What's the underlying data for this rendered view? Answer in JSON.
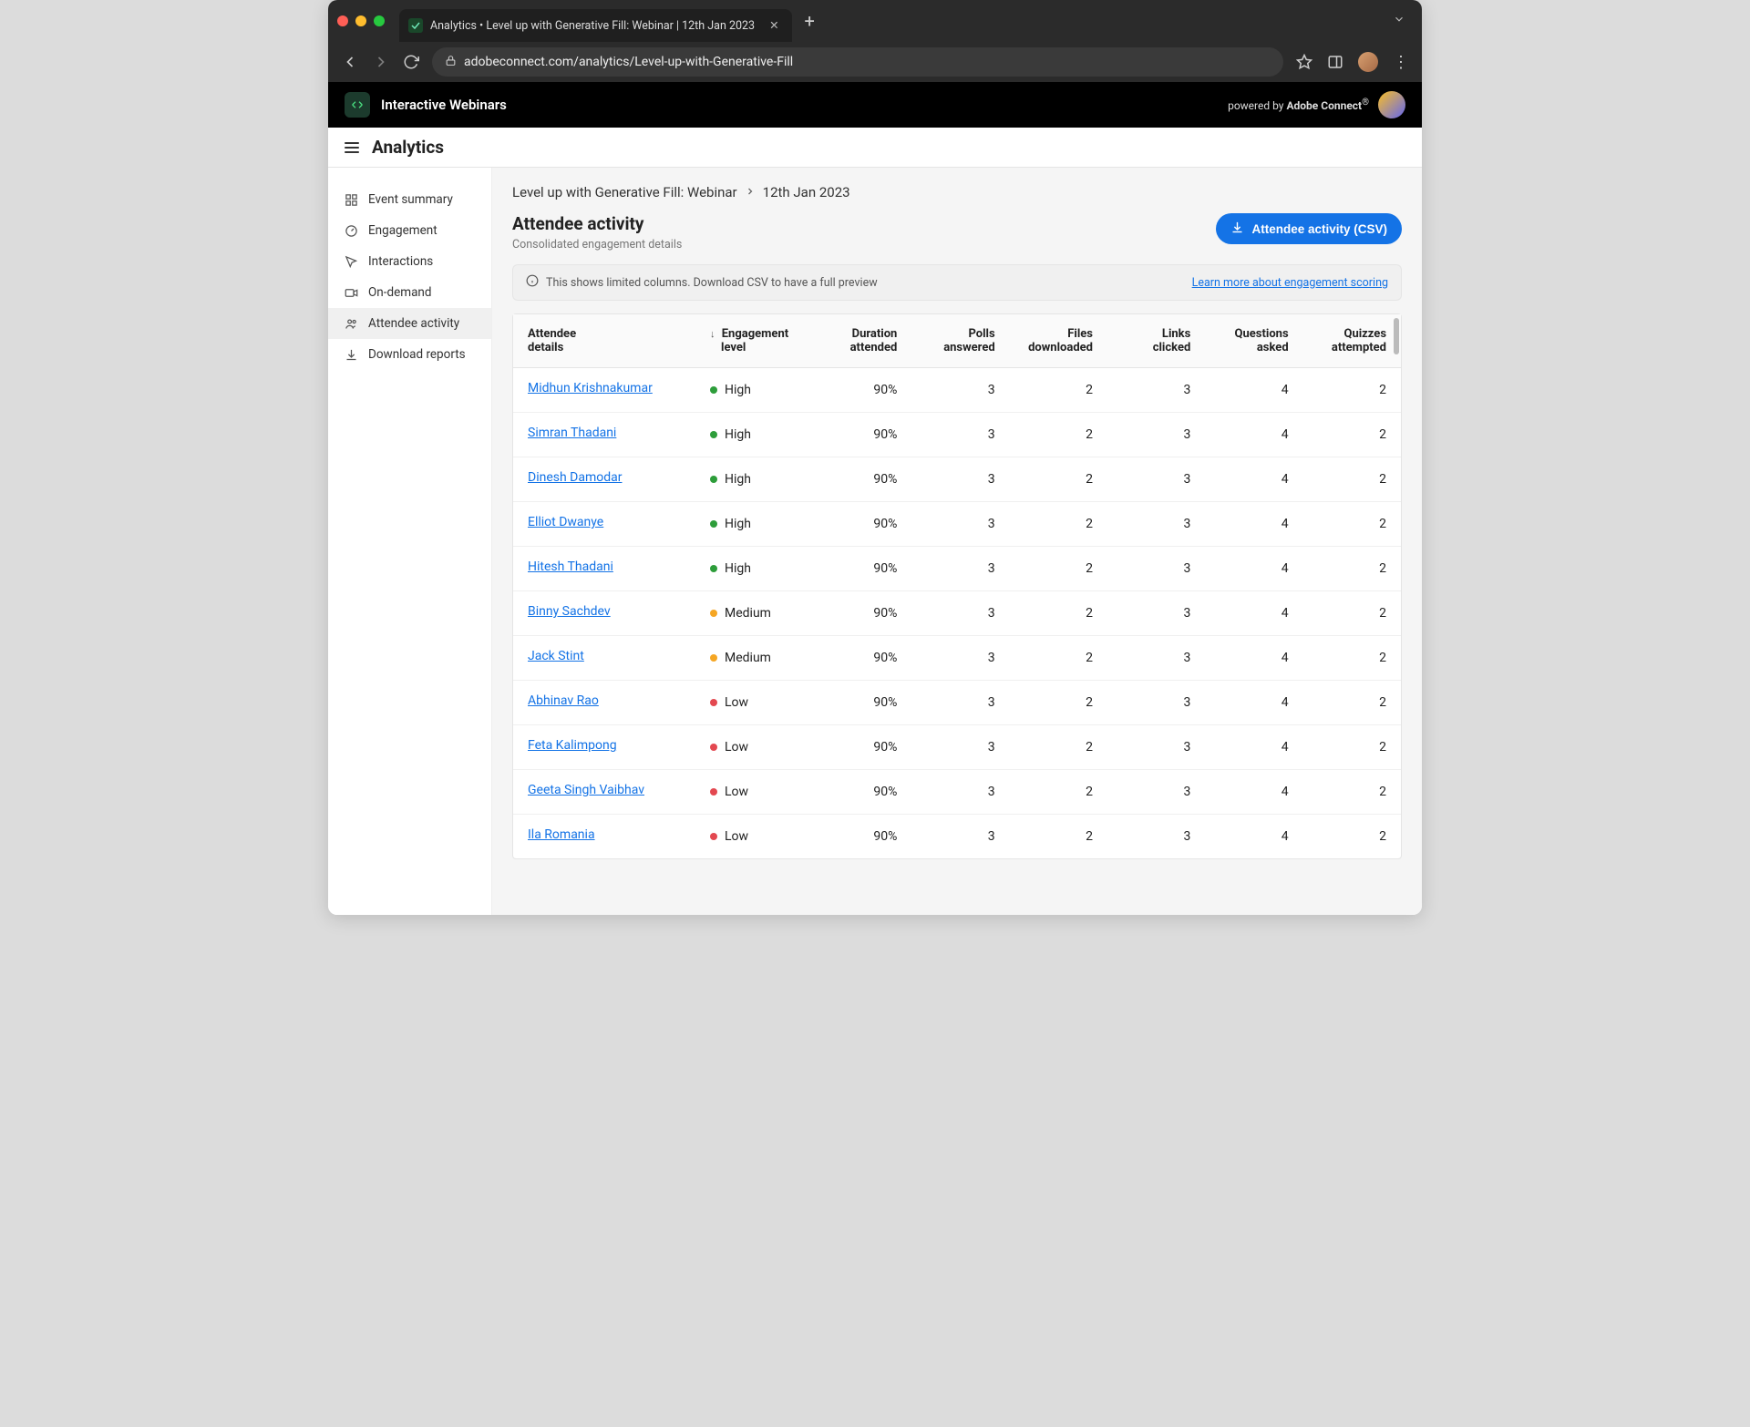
{
  "browser": {
    "tab_title": "Analytics • Level up with Generative Fill: Webinar | 12th Jan 2023",
    "url": "adobeconnect.com/analytics/Level-up-with-Generative-Fill"
  },
  "app_header": {
    "brand": "Interactive Webinars",
    "powered_prefix": "powered by ",
    "powered_brand": "Adobe Connect",
    "powered_suffix": "®"
  },
  "page": {
    "title": "Analytics",
    "breadcrumb_event": "Level up with Generative Fill: Webinar",
    "breadcrumb_date": "12th Jan 2023",
    "section_title": "Attendee activity",
    "section_subtitle": "Consolidated engagement details",
    "export_button": "Attendee activity (CSV)",
    "info_text": "This shows limited columns. Download CSV to have a full preview",
    "learn_more": "Learn more about engagement scoring"
  },
  "sidebar": {
    "items": [
      {
        "label": "Event summary"
      },
      {
        "label": "Engagement"
      },
      {
        "label": "Interactions"
      },
      {
        "label": "On-demand"
      },
      {
        "label": "Attendee activity"
      },
      {
        "label": "Download reports"
      }
    ]
  },
  "table": {
    "columns": [
      {
        "l1": "Attendee",
        "l2": "details"
      },
      {
        "l1": "Engagement",
        "l2": "level"
      },
      {
        "l1": "Duration",
        "l2": "attended"
      },
      {
        "l1": "Polls",
        "l2": "answered"
      },
      {
        "l1": "Files",
        "l2": "downloaded"
      },
      {
        "l1": "Links",
        "l2": "clicked"
      },
      {
        "l1": "Questions",
        "l2": "asked"
      },
      {
        "l1": "Quizzes",
        "l2": "attempted"
      }
    ],
    "rows": [
      {
        "name": "Midhun Krishnakumar",
        "level": "High",
        "duration": "90%",
        "polls": "3",
        "files": "2",
        "links": "3",
        "questions": "4",
        "quizzes": "2"
      },
      {
        "name": "Simran Thadani",
        "level": "High",
        "duration": "90%",
        "polls": "3",
        "files": "2",
        "links": "3",
        "questions": "4",
        "quizzes": "2"
      },
      {
        "name": "Dinesh Damodar",
        "level": "High",
        "duration": "90%",
        "polls": "3",
        "files": "2",
        "links": "3",
        "questions": "4",
        "quizzes": "2"
      },
      {
        "name": "Elliot Dwanye",
        "level": "High",
        "duration": "90%",
        "polls": "3",
        "files": "2",
        "links": "3",
        "questions": "4",
        "quizzes": "2"
      },
      {
        "name": "Hitesh Thadani",
        "level": "High",
        "duration": "90%",
        "polls": "3",
        "files": "2",
        "links": "3",
        "questions": "4",
        "quizzes": "2"
      },
      {
        "name": "Binny Sachdev",
        "level": "Medium",
        "duration": "90%",
        "polls": "3",
        "files": "2",
        "links": "3",
        "questions": "4",
        "quizzes": "2"
      },
      {
        "name": "Jack Stint",
        "level": "Medium",
        "duration": "90%",
        "polls": "3",
        "files": "2",
        "links": "3",
        "questions": "4",
        "quizzes": "2"
      },
      {
        "name": "Abhinav Rao",
        "level": "Low",
        "duration": "90%",
        "polls": "3",
        "files": "2",
        "links": "3",
        "questions": "4",
        "quizzes": "2"
      },
      {
        "name": "Feta Kalimpong",
        "level": "Low",
        "duration": "90%",
        "polls": "3",
        "files": "2",
        "links": "3",
        "questions": "4",
        "quizzes": "2"
      },
      {
        "name": "Geeta Singh Vaibhav",
        "level": "Low",
        "duration": "90%",
        "polls": "3",
        "files": "2",
        "links": "3",
        "questions": "4",
        "quizzes": "2"
      },
      {
        "name": "Ila Romania",
        "level": "Low",
        "duration": "90%",
        "polls": "3",
        "files": "2",
        "links": "3",
        "questions": "4",
        "quizzes": "2"
      }
    ]
  }
}
